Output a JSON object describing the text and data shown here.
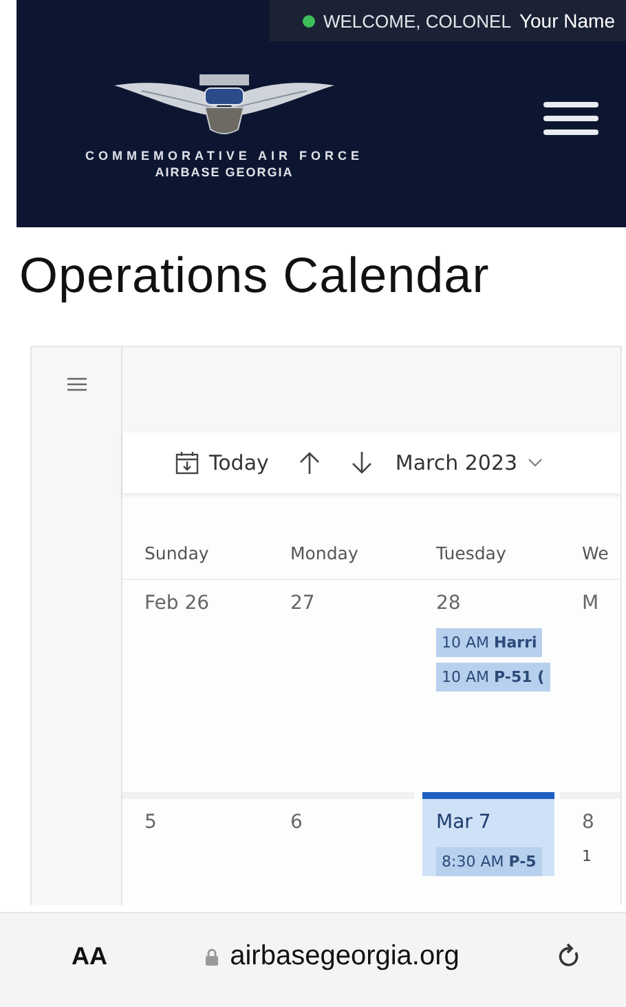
{
  "top_bar": {
    "online": true,
    "welcome": "WELCOME, COLONEL",
    "user": "Your Name"
  },
  "header": {
    "org_name": "COMMEMORATIVE AIR FORCE",
    "org_sub": "AIRBASE GEORGIA"
  },
  "page_title": "Operations Calendar",
  "calendar": {
    "toolbar": {
      "today": "Today",
      "month": "March 2023"
    },
    "weekdays": [
      "Sunday",
      "Monday",
      "Tuesday",
      "We"
    ],
    "weeks": [
      {
        "days": [
          {
            "date": "Feb 26",
            "today": false
          },
          {
            "date": "27",
            "today": false
          },
          {
            "date": "28",
            "today": false,
            "events": [
              {
                "kind": "chip",
                "text": "10 AM **Harri**"
              },
              {
                "kind": "chip",
                "text": "10 AM **P-51 (**"
              }
            ]
          },
          {
            "date": "M",
            "today": false
          }
        ]
      },
      {
        "days": [
          {
            "date": "5",
            "today": false
          },
          {
            "date": "6",
            "today": false
          },
          {
            "date": "Mar 7",
            "today": true,
            "events": [
              {
                "kind": "chip",
                "text": "8:30 AM **P-5**"
              }
            ]
          },
          {
            "date": "8",
            "today": false,
            "events": [
              {
                "kind": "plain",
                "text": "1"
              }
            ]
          }
        ]
      }
    ]
  },
  "browser_bar": {
    "text_size": "AA",
    "url": "airbasegeorgia.org"
  }
}
